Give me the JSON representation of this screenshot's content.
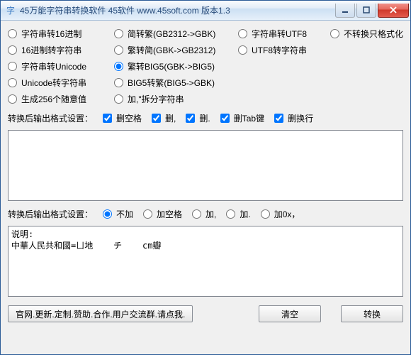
{
  "window": {
    "title": "45万能字符串转换软件 45软件 www.45soft.com 版本1.3"
  },
  "modes": {
    "col1": [
      "字符串转16进制",
      "16进制转字符串",
      "字符串转Unicode",
      "Unicode转字符串",
      "生成256个随意值"
    ],
    "col2": [
      "简转繁(GB2312->GBK)",
      "繁转简(GBK->GB2312)",
      "繁转BIG5(GBK->BIG5)",
      "BIG5转繁(BIG5->GBK)",
      "加,\"拆分字符串"
    ],
    "col3": [
      "字符串转UTF8",
      "UTF8转字符串"
    ],
    "col4": [
      "不转换只格式化"
    ],
    "selected": "繁转BIG5(GBK->BIG5)"
  },
  "trim": {
    "label": "转换后输出格式设置：",
    "options": [
      {
        "label": "删空格",
        "checked": true
      },
      {
        "label": "删,",
        "checked": true
      },
      {
        "label": "删.",
        "checked": true
      },
      {
        "label": "删Tab键",
        "checked": true
      },
      {
        "label": "删换行",
        "checked": true
      }
    ]
  },
  "sep": {
    "label": "转换后输出格式设置：",
    "options": [
      "不加",
      "加空格",
      "加,",
      "加.",
      "加0x，"
    ],
    "selected": "不加"
  },
  "input_text": "",
  "output_text": "说明:\n中華人民共和國=ㄩ地    チ    cm瓣",
  "buttons": {
    "link": "官网.更新.定制.赞助.合作.用户交流群.请点我.",
    "clear": "清空",
    "convert": "转换"
  }
}
